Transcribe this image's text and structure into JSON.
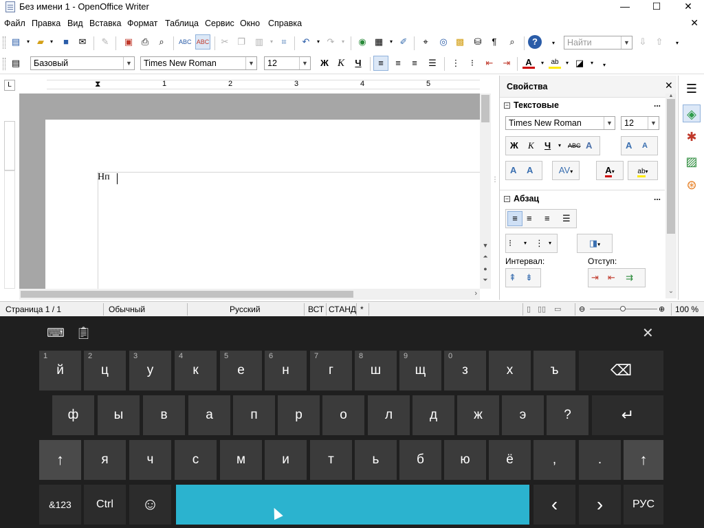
{
  "window": {
    "title": "Без имени 1 - OpenOffice Writer",
    "minimize_label": "—",
    "maximize_label": "☐",
    "close_label": "✕"
  },
  "menu": {
    "items": [
      "Файл",
      "Правка",
      "Вид",
      "Вставка",
      "Формат",
      "Таблица",
      "Сервис",
      "Окно",
      "Справка"
    ],
    "doc_close_label": "✕"
  },
  "toolbar1": {
    "find_placeholder": "Найти"
  },
  "toolbar2": {
    "style": "Базовый",
    "font": "Times New Roman",
    "size": "12",
    "bold_label": "Ж",
    "italic_label": "К",
    "underline_label": "Ч"
  },
  "ruler": {
    "numbers": [
      "1",
      "2",
      "3",
      "4",
      "5"
    ]
  },
  "document": {
    "text": "Нп"
  },
  "sidebar": {
    "title": "Свойства",
    "close_label": "✕",
    "text_section": {
      "title": "Текстовые",
      "font": "Times New Roman",
      "size": "12",
      "bold_label": "Ж",
      "italic_label": "К",
      "underline_label": "Ч",
      "strike_label": "ABC"
    },
    "paragraph_section": {
      "title": "Абзац",
      "spacing_label": "Интервал:",
      "indent_label": "Отступ:"
    },
    "more_label": "..."
  },
  "statusbar": {
    "page": "Страница  1 / 1",
    "style": "Обычный",
    "language": "Русский",
    "insert_mode": "ВСТ",
    "selection_mode": "СТАНД",
    "modified": "*",
    "zoom": "100 %"
  },
  "keyboard": {
    "row1": [
      {
        "label": "й",
        "hint": "1"
      },
      {
        "label": "ц",
        "hint": "2"
      },
      {
        "label": "у",
        "hint": "3"
      },
      {
        "label": "к",
        "hint": "4"
      },
      {
        "label": "е",
        "hint": "5"
      },
      {
        "label": "н",
        "hint": "6"
      },
      {
        "label": "г",
        "hint": "7"
      },
      {
        "label": "ш",
        "hint": "8"
      },
      {
        "label": "щ",
        "hint": "9"
      },
      {
        "label": "з",
        "hint": "0"
      },
      {
        "label": "х",
        "hint": ""
      },
      {
        "label": "ъ",
        "hint": ""
      }
    ],
    "backspace_label": "⌫",
    "row2": [
      "ф",
      "ы",
      "в",
      "а",
      "п",
      "р",
      "о",
      "л",
      "д",
      "ж",
      "э",
      "?"
    ],
    "enter_label": "↵",
    "shift_label": "↑",
    "row3": [
      "я",
      "ч",
      "с",
      "м",
      "и",
      "т",
      "ь",
      "б",
      "ю",
      "ё",
      ",",
      "."
    ],
    "symbols_label": "&123",
    "ctrl_label": "Ctrl",
    "emoji_label": "☺",
    "left_label": "‹",
    "right_label": "›",
    "lang_label": "РУС",
    "close_label": "✕"
  },
  "colors": {
    "accent_space": "#2bb3cf",
    "key_bg": "#3b3b3b",
    "keyboard_bg": "#1f1f1f"
  }
}
